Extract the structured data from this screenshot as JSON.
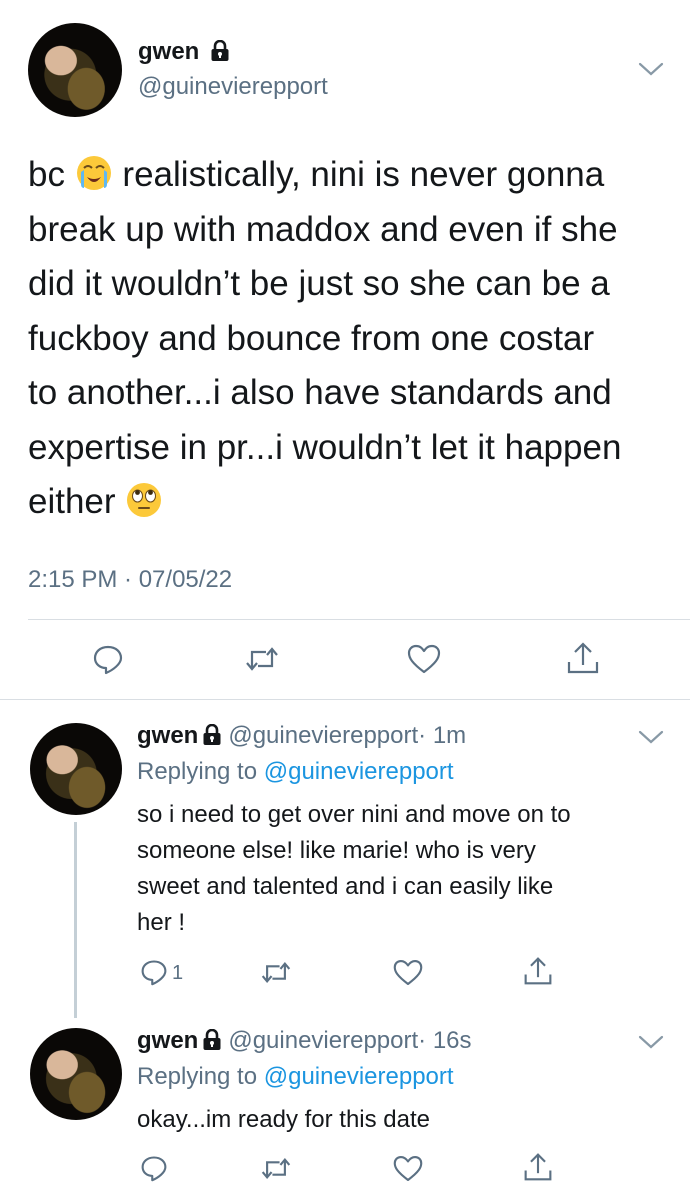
{
  "main_tweet": {
    "name": "gwen",
    "handle": "@guinevierepport",
    "text_parts": {
      "p1": "bc ",
      "emoji1": "loudly-crying-face-emoji",
      "p2": " realistically, nini is never gonna\nbreak up with maddox and even if she\ndid it wouldn’t be just so she can be a\nfuckboy and bounce from one costar\nto another...i also have standards and\nexpertise in pr...i wouldn’t let it happen\neither ",
      "emoji2": "face-with-rolling-eyes-emoji"
    },
    "timestamp": "2:15 PM · 07/05/22",
    "actions": [
      "reply-icon",
      "retweet-icon",
      "like-icon",
      "share-icon"
    ]
  },
  "replies": [
    {
      "name": "gwen",
      "handle": "@guinevierepport",
      "time": "· 1m",
      "replying_label": "Replying to",
      "replying_to": "@guinevierepport",
      "text": "so i need to get over nini and move on to\nsomeone else! like marie! who is very\nsweet and talented and i can easily like\nher !",
      "reply_count": "1"
    },
    {
      "name": "gwen",
      "handle": "@guinevierepport",
      "time": "· 16s",
      "replying_label": "Replying to",
      "replying_to": "@guinevierepport",
      "text": "okay...im ready for this date",
      "reply_count": ""
    }
  ],
  "colors": {
    "text": "#14171a",
    "secondary": "#5b7083",
    "link": "#1b95e0",
    "divider": "#d9dee3"
  }
}
